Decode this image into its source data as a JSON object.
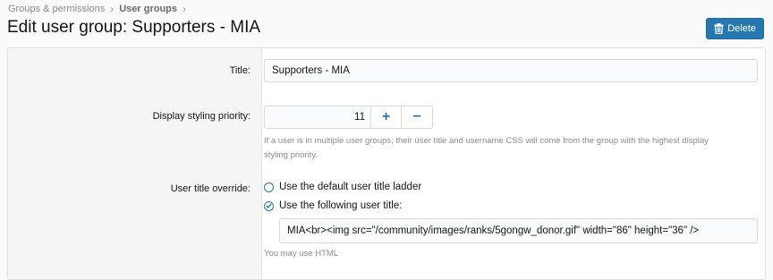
{
  "breadcrumb": {
    "items": [
      "Groups & permissions",
      "User groups"
    ],
    "separator_icon": "chevron-right-icon"
  },
  "page": {
    "title": "Edit user group: Supporters - MIA"
  },
  "actions": {
    "delete_label": "Delete",
    "delete_icon": "trash-icon",
    "accent_color": "#2577b1"
  },
  "form": {
    "title_label": "Title:",
    "title_value": "Supporters - MIA",
    "priority_label": "Display styling priority:",
    "priority_value": "11",
    "priority_increment": "+",
    "priority_decrement": "−",
    "priority_hint_line1": "If a user is in multiple user groups, their user title and username CSS will come from the group with the highest display",
    "priority_hint_line2": "styling priority.",
    "override_label": "User title override:",
    "option_default": "Use the default user title ladder",
    "option_following": "Use the following user title:",
    "selected_option": "Use the following user title:",
    "custom_title_value": "MIA<br><img src=\"/community/images/ranks/5gongw_donor.gif\" width=\"86\" height=\"36\" />",
    "custom_title_hint": "You may use HTML"
  }
}
